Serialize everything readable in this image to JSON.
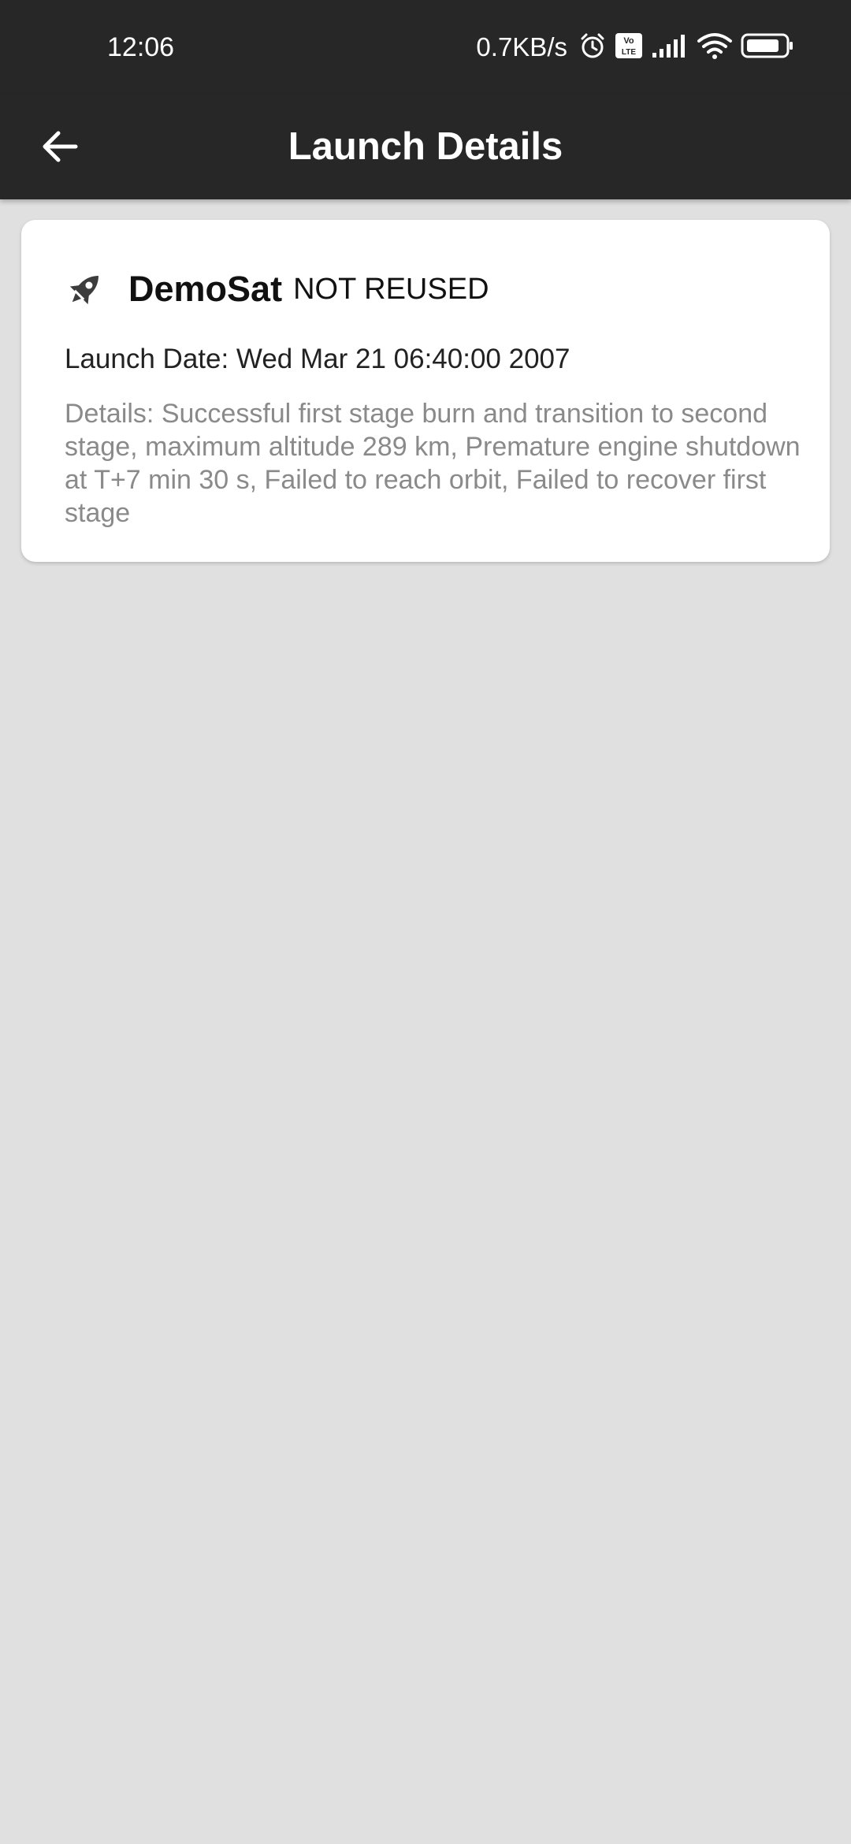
{
  "status_bar": {
    "time": "12:06",
    "net_speed": "0.7KB/s",
    "icons": [
      "alarm-icon",
      "volte-icon",
      "signal-icon",
      "wifi-icon",
      "battery-icon"
    ]
  },
  "app_bar": {
    "title": "Launch Details",
    "back_icon": "arrow-back-icon"
  },
  "launch": {
    "mission_name": "DemoSat",
    "reuse_status": "NOT REUSED",
    "launch_date": "Launch Date: Wed Mar 21 06:40:00 2007",
    "details": "Details: Successful first stage burn and transition to second stage, maximum altitude 289 km, Premature engine shutdown at T+7 min 30 s, Failed to reach orbit, Failed to recover first stage",
    "icon": "rocket-icon"
  },
  "colors": {
    "app_bar": "#272727",
    "background": "#e0e0e0",
    "card": "#ffffff",
    "details_text": "#8a8a8a",
    "icon": "#3c3c3c"
  }
}
